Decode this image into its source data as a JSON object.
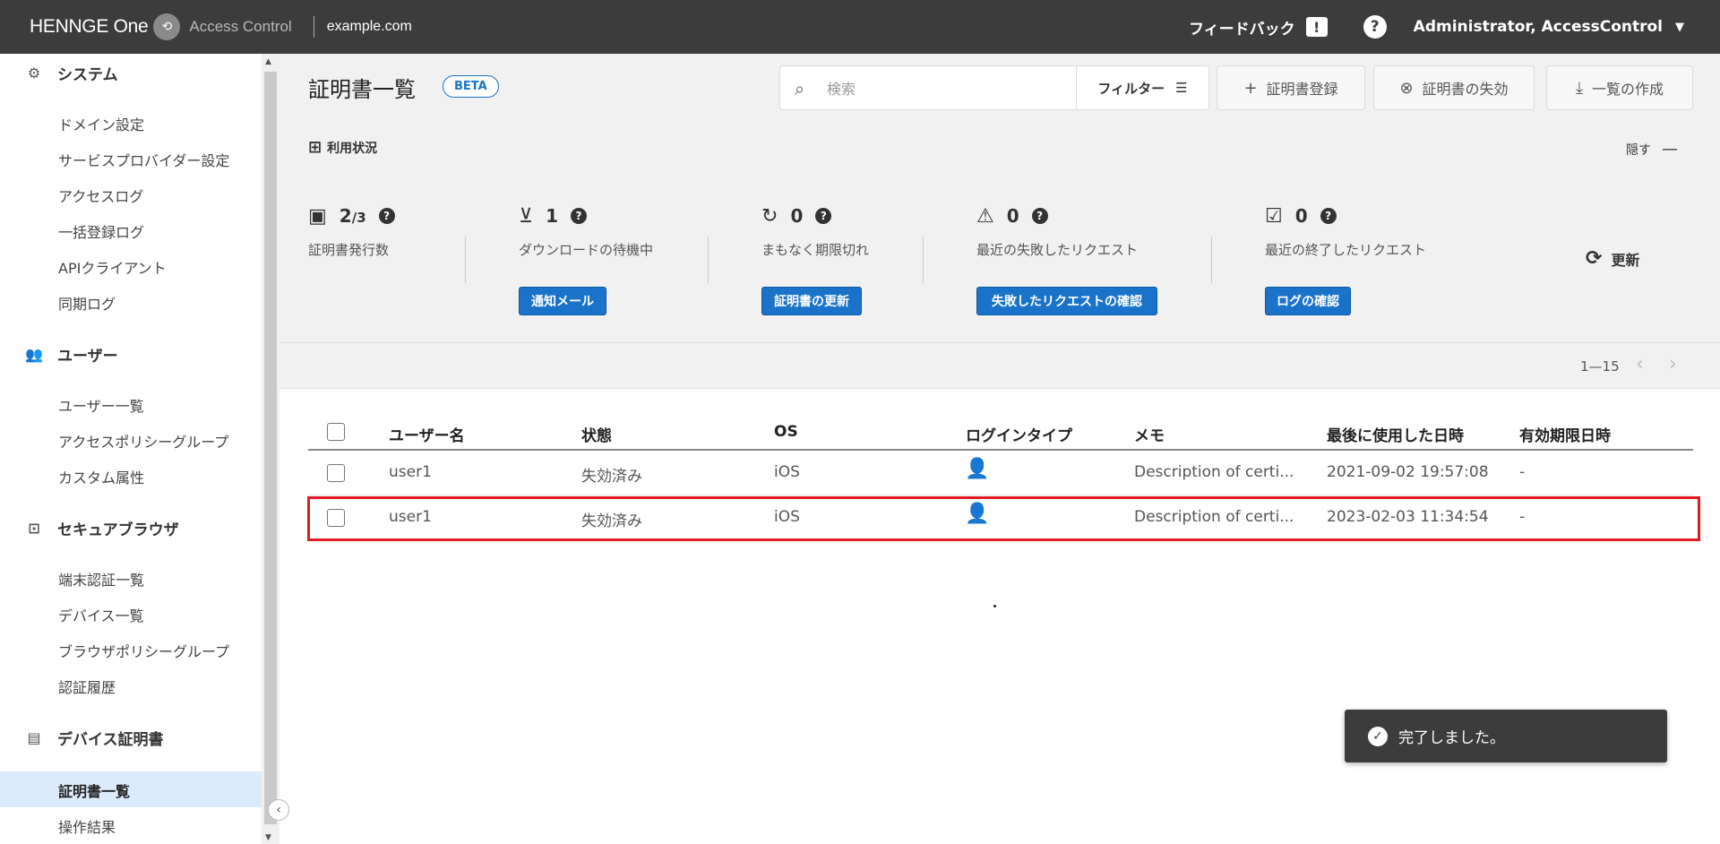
{
  "topbar": {
    "brand": "HENNGE One",
    "product": "Access Control",
    "domain": "example.com",
    "feedback": "フィードバック",
    "user": "Administrator, AccessControl"
  },
  "sidebar": {
    "sections": [
      {
        "label": "システム",
        "icon": "gear-icon",
        "items": [
          "ドメイン設定",
          "サービスプロバイダー設定",
          "アクセスログ",
          "一括登録ログ",
          "APIクライアント",
          "同期ログ"
        ]
      },
      {
        "label": "ユーザー",
        "icon": "users-icon",
        "items": [
          "ユーザー一覧",
          "アクセスポリシーグループ",
          "カスタム属性"
        ]
      },
      {
        "label": "セキュアブラウザ",
        "icon": "secure-browser-icon",
        "items": [
          "端末認証一覧",
          "デバイス一覧",
          "ブラウザポリシーグループ",
          "認証履歴"
        ]
      },
      {
        "label": "デバイス証明書",
        "icon": "certificate-icon",
        "items": [
          "証明書一覧",
          "操作結果"
        ]
      }
    ],
    "active_item": "証明書一覧"
  },
  "page": {
    "title": "証明書一覧",
    "badge": "BETA",
    "search_placeholder": "検索",
    "filter_label": "フィルター",
    "register_label": "証明書登録",
    "revoke_label": "証明書の失効",
    "export_label": "一覧の作成"
  },
  "usage": {
    "title": "利用状況",
    "hide_label": "隠す",
    "refresh_label": "更新",
    "stats": [
      {
        "icon": "certificate-issued-icon",
        "value": "2",
        "total": "/3",
        "label": "証明書発行数",
        "button": ""
      },
      {
        "icon": "download-pending-icon",
        "value": "1",
        "label": "ダウンロードの待機中",
        "button": "通知メール"
      },
      {
        "icon": "expiring-soon-icon",
        "value": "0",
        "label": "まもなく期限切れ",
        "button": "証明書の更新"
      },
      {
        "icon": "failed-request-icon",
        "value": "0",
        "label": "最近の失敗したリクエスト",
        "button": "失敗したリクエストの確認"
      },
      {
        "icon": "completed-request-icon",
        "value": "0",
        "label": "最近の終了したリクエスト",
        "button": "ログの確認"
      }
    ]
  },
  "pagination": {
    "range": "1—15"
  },
  "table": {
    "columns": [
      "ユーザー名",
      "状態",
      "OS",
      "ログインタイプ",
      "メモ",
      "最後に使用した日時",
      "有効期限日時"
    ],
    "rows": [
      {
        "user": "user1",
        "status": "失効済み",
        "os": "iOS",
        "login_type": "user-certificate-icon",
        "memo": "Description of certi...",
        "last_used": "2021-09-02 19:57:08",
        "expires": "-"
      },
      {
        "user": "user1",
        "status": "失効済み",
        "os": "iOS",
        "login_type": "user-certificate-icon",
        "memo": "Description of certi...",
        "last_used": "2023-02-03 11:34:54",
        "expires": "-"
      }
    ]
  },
  "toast": {
    "message": "完了しました。"
  }
}
